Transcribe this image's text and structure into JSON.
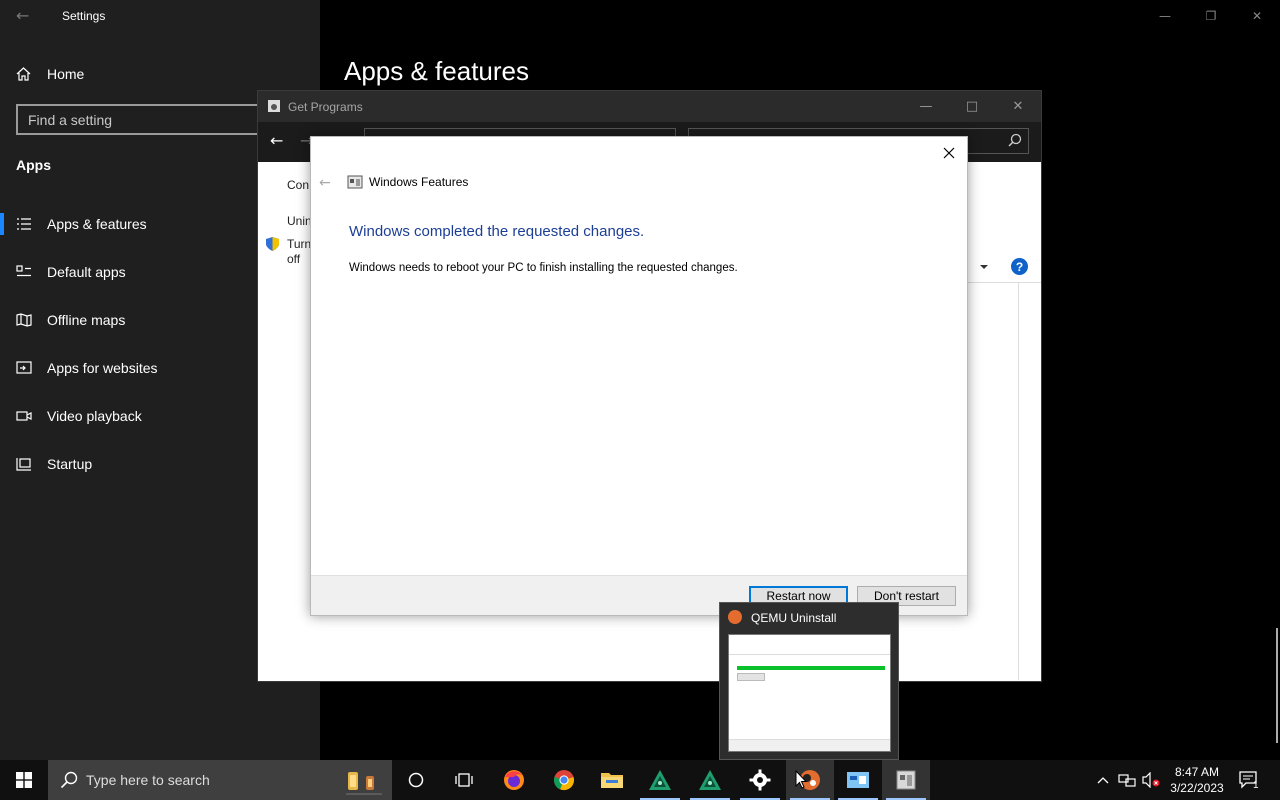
{
  "settings": {
    "window_title": "Settings",
    "home_label": "Home",
    "search_placeholder": "Find a setting",
    "section_title": "Apps",
    "page_title": "Apps & features",
    "nav_items": [
      {
        "label": "Apps & features",
        "icon": "list-icon",
        "active": true
      },
      {
        "label": "Default apps",
        "icon": "default-apps-icon"
      },
      {
        "label": "Offline maps",
        "icon": "map-icon"
      },
      {
        "label": "Apps for websites",
        "icon": "website-icon"
      },
      {
        "label": "Video playback",
        "icon": "video-icon"
      },
      {
        "label": "Startup",
        "icon": "startup-icon"
      }
    ]
  },
  "get_programs": {
    "title": "Get Programs",
    "side_links": [
      "Con",
      "Unin",
      "Turn",
      "off"
    ]
  },
  "windows_features": {
    "title": "Windows Features",
    "heading": "Windows completed the requested changes.",
    "body": "Windows needs to reboot your PC to finish installing the requested changes.",
    "restart_label": "Restart now",
    "dont_restart_label": "Don't restart"
  },
  "preview": {
    "title": "QEMU Uninstall"
  },
  "taskbar": {
    "search_placeholder": "Type here to search",
    "time": "8:47 AM",
    "date": "3/22/2023",
    "notification_count": "1"
  },
  "colors": {
    "accent": "#0078d7",
    "heading_blue": "#1c3f95",
    "progress_green": "#0ac12b"
  }
}
